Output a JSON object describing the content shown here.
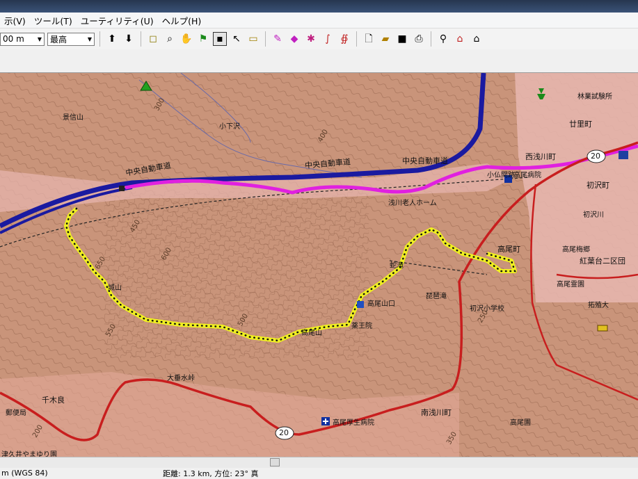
{
  "menu": {
    "items": [
      "示(V)",
      "ツール(T)",
      "ユーティリティ(U)",
      "ヘルプ(H)"
    ]
  },
  "toolbar": {
    "scale_value": "00 m",
    "detail_value": "最高",
    "icons": [
      "map-add-icon",
      "map-remove-icon",
      "select-region-icon",
      "zoom-icon",
      "pan-hand-icon",
      "flag-icon",
      "selection-box-icon",
      "pointer-icon",
      "measure-icon",
      "waypoint-marker-icon",
      "eraser-icon",
      "track-draw-icon",
      "route-icon",
      "route-edit-icon",
      "new-file-icon",
      "open-folder-icon",
      "save-icon",
      "print-icon",
      "find-icon",
      "find-nearby-icon",
      "find-address-icon"
    ]
  },
  "map": {
    "road_labels": [
      "中央自動車道",
      "中央自動車道",
      "中央自動車道"
    ],
    "places": [
      "千木良",
      "西浅川町",
      "高尾町",
      "南浅川町",
      "紅葉台二区団",
      "初沢町",
      "初沢川",
      "廿里町",
      "浅川老人ホーム",
      "高尾病院",
      "高尾厚生病院",
      "大垂水峠",
      "陣馬山",
      "城山",
      "高尾山",
      "薬王院",
      "高尾山口",
      "蛇滝",
      "琵琶滝",
      "高尾園",
      "林業試験所",
      "郵便局",
      "津久井やまゆり園",
      "小仏関跡",
      "高尾梅郷",
      "初沢小学校",
      "高尾霊園",
      "拓殖大",
      "霞台",
      "小下沢",
      "景信山"
    ],
    "route_shields": [
      "20",
      "20"
    ],
    "contours": [
      "300",
      "350",
      "400",
      "450",
      "500",
      "550",
      "600",
      "650",
      "700",
      "250",
      "200"
    ]
  },
  "status": {
    "coords": "m (WGS 84)",
    "distance": "距離: 1.3 km, 方位: 23° 真"
  },
  "colors": {
    "highway": "#1a1aa0",
    "track_magenta": "#e020e0",
    "track_yellow": "#f0f020",
    "road_red": "#c81e1e",
    "terrain": "#c9947a"
  }
}
